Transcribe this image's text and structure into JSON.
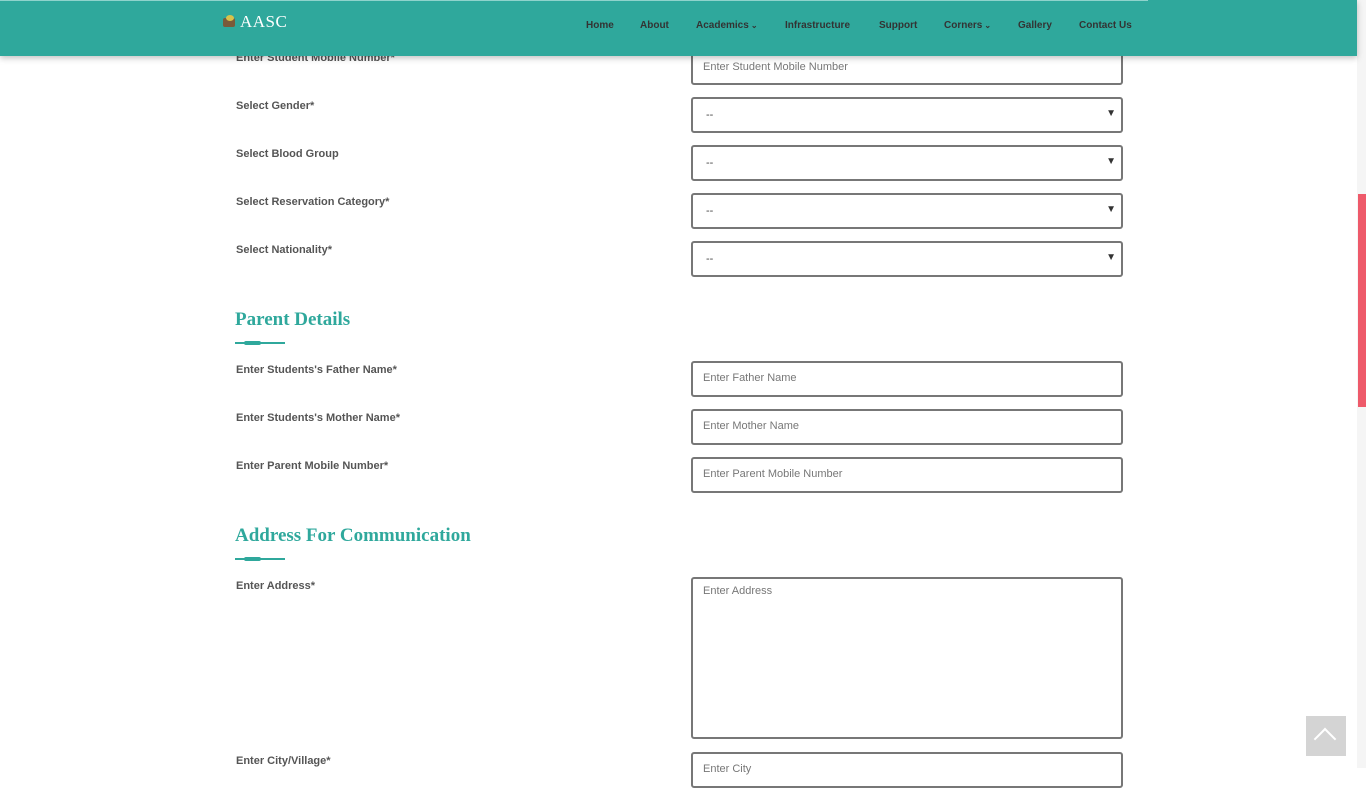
{
  "header": {
    "logo_text": "AASC",
    "nav": [
      "Home",
      "About",
      "Academics",
      "Infrastructure",
      "Support",
      "Corners",
      "Gallery",
      "Contact Us"
    ]
  },
  "student": {
    "mobile_label": "Enter Student Mobile Number*",
    "mobile_placeholder": "Enter Student Mobile Number",
    "gender_label": "Select Gender*",
    "gender_value": "--",
    "blood_label": "Select Blood Group",
    "blood_value": "--",
    "reservation_label": "Select Reservation Category*",
    "reservation_value": "--",
    "nationality_label": "Select Nationality*",
    "nationality_value": "--"
  },
  "parent": {
    "title": "Parent Details",
    "father_label": "Enter Students's Father Name*",
    "father_placeholder": "Enter Father Name",
    "mother_label": "Enter Students's Mother Name*",
    "mother_placeholder": "Enter Mother Name",
    "mobile_label": "Enter Parent Mobile Number*",
    "mobile_placeholder": "Enter Parent Mobile Number"
  },
  "address": {
    "title": "Address For Communication",
    "address_label": "Enter Address*",
    "address_placeholder": "Enter Address",
    "city_label": "Enter City/Village*",
    "city_placeholder": "Enter City"
  },
  "colors": {
    "accent": "#2fa89c",
    "scroll_thumb": "#ee5a6a"
  }
}
